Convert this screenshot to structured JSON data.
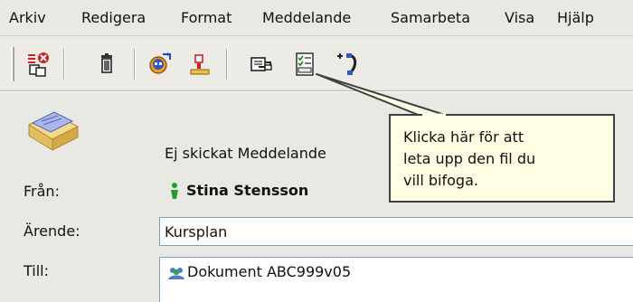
{
  "menu": {
    "items": [
      "Arkiv",
      "Redigera",
      "Format",
      "Meddelande",
      "Samarbeta",
      "Visa",
      "Hjälp"
    ]
  },
  "toolbar": {
    "icons": [
      "send-status-icon",
      "trash-icon",
      "reply-person-icon",
      "person-user-icon",
      "attach-file-icon",
      "checklist-icon",
      "phone-add-icon"
    ]
  },
  "message": {
    "status": "Ej skickat Meddelande",
    "from_label": "Från:",
    "from_value": "Stina Stensson",
    "subject_label": "Ärende:",
    "subject_value": "Kursplan",
    "to_label": "Till:",
    "to_value": "Dokument ABC999v05"
  },
  "tooltip": {
    "line1": "Klicka här för att",
    "line2": "leta upp den fil du",
    "line3": "vill bifoga."
  },
  "colors": {
    "background": "#e9e9e3",
    "tooltip_bg": "#ffffe6",
    "field_border": "#7f9db9"
  }
}
